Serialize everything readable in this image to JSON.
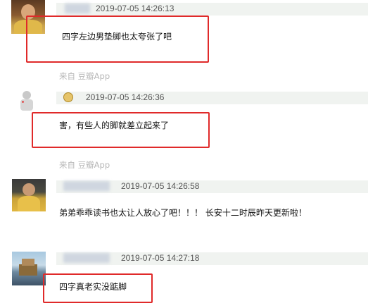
{
  "comments": [
    {
      "timestamp": "2019-07-05 14:26:13",
      "text": "四字左边男垫脚也太夸张了吧",
      "source": "来自 豆瓣App"
    },
    {
      "timestamp": "2019-07-05 14:26:36",
      "text": "害，有些人的脚就差立起来了",
      "source": "来自 豆瓣App"
    },
    {
      "timestamp": "2019-07-05 14:26:58",
      "text": "弟弟乖乖读书也太让人放心了吧！！！ 长安十二时辰昨天更新啦！",
      "source": ""
    },
    {
      "timestamp": "2019-07-05 14:27:18",
      "text": "四字真老实没踮脚",
      "source": ""
    }
  ],
  "colors": {
    "highlight_box": "#e02a2a",
    "source_text": "#b7b7b7",
    "meta_band": "#f0f3f0"
  }
}
